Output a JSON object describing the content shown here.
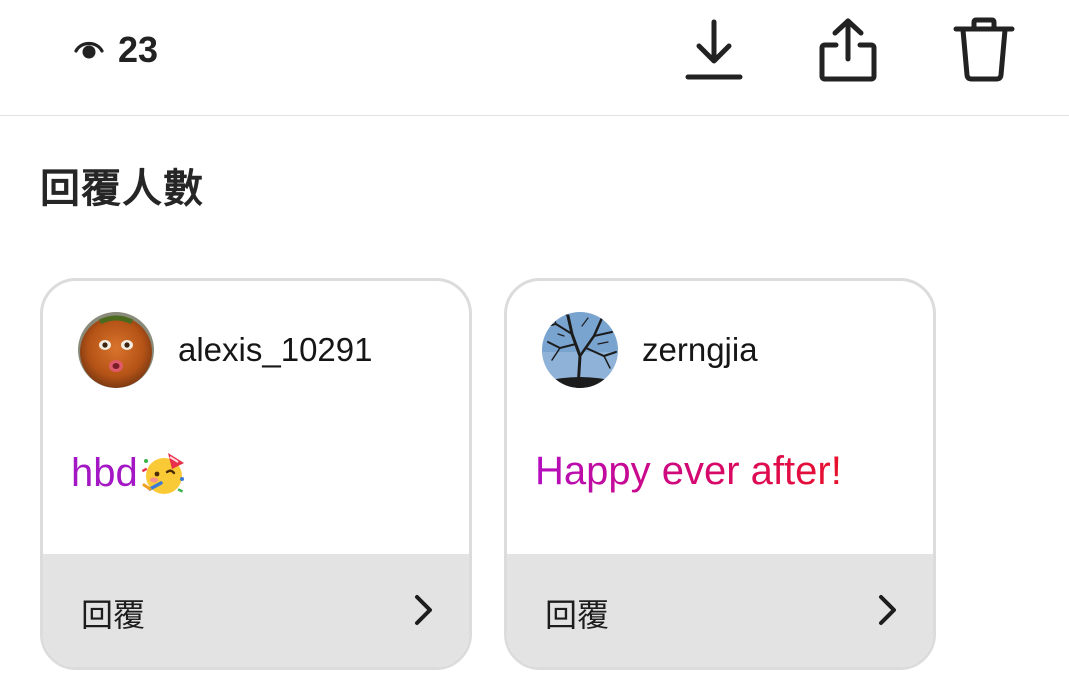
{
  "header": {
    "view_count": "23",
    "icons": [
      "eye-icon",
      "download-icon",
      "share-icon",
      "trash-icon"
    ]
  },
  "section": {
    "title": "回覆人數"
  },
  "replies": [
    {
      "username": "alexis_10291",
      "message": "hbd",
      "message_emoji": "partying-face-emoji",
      "message_color": "#a417c4",
      "reply_label": "回覆",
      "avatar": "orange-face-avatar"
    },
    {
      "username": "zerngjia",
      "message": "Happy ever after!",
      "message_colors": [
        "#b40ec0",
        "#d6076e",
        "#e8112a"
      ],
      "reply_label": "回覆",
      "avatar": "tree-branches-sky-avatar"
    }
  ],
  "colors": {
    "divider": "#e2e2e2",
    "card_border": "#dcdcdc",
    "footer_bg": "#e3e3e3"
  }
}
